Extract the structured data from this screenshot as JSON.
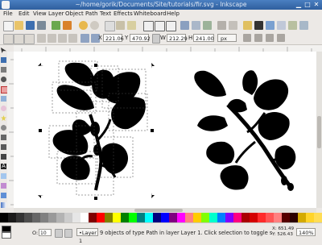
{
  "window": {
    "title": "~/home/gorik/Documents/Site/tutorials/fir.svg - Inkscape"
  },
  "menu": [
    "File",
    "Edit",
    "View",
    "Layer",
    "Object",
    "Path",
    "Text",
    "Effects",
    "Whiteboard",
    "Help"
  ],
  "toolbar2": {
    "x_label": "X",
    "x_value": "221.06",
    "y_label": "Y",
    "y_value": "470.92",
    "w_label": "W",
    "w_value": "212.29",
    "h_label": "H",
    "h_value": "241.00",
    "unit": "px"
  },
  "status": {
    "opacity_label": "O:",
    "opacity_value": "10",
    "layer": "•Layer 1",
    "message": "9 objects of type Path in layer Layer 1. Click selection to toggle s",
    "cursor_x": "X: 651.49",
    "cursor_y": "Y: 526.43",
    "zoom": "140%"
  },
  "colors": {
    "palette": [
      "#000000",
      "#1a1a1a",
      "#333333",
      "#4d4d4d",
      "#666666",
      "#808080",
      "#999999",
      "#b3b3b3",
      "#cccccc",
      "#e6e6e6",
      "#ffffff",
      "#800000",
      "#ff0000",
      "#808000",
      "#ffff00",
      "#008000",
      "#00ff00",
      "#008080",
      "#00ffff",
      "#000080",
      "#0000ff",
      "#800080",
      "#ff00ff",
      "#ff8080",
      "#ffcc00",
      "#80ff00",
      "#00ffcc",
      "#0080ff",
      "#8000ff",
      "#ff0080",
      "#aa0000",
      "#d40000",
      "#ff2a2a",
      "#ff5555",
      "#ff8080",
      "#550000",
      "#2b0000",
      "#d4aa00",
      "#ffd42a",
      "#ffdd55"
    ]
  }
}
